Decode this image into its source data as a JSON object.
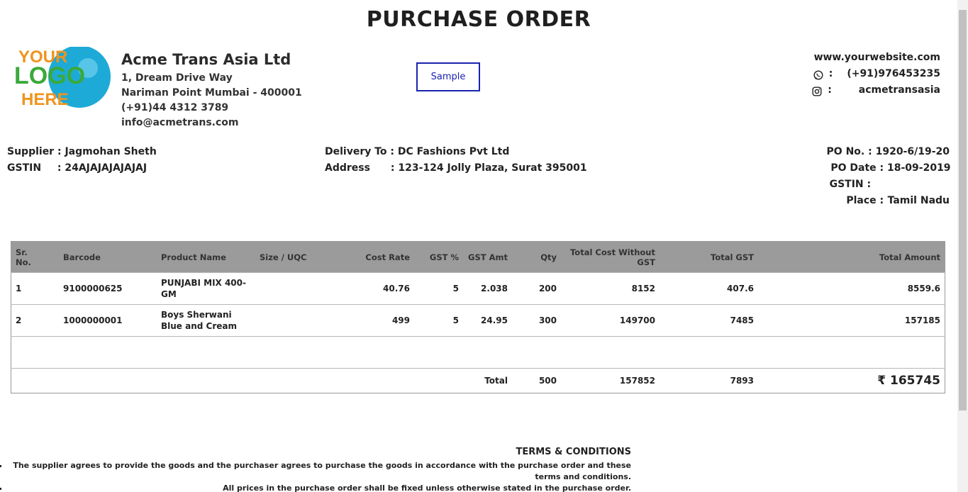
{
  "title": "PURCHASE ORDER",
  "logo": {
    "line1": "YOUR",
    "line2": "LOGO",
    "line3": "HERE"
  },
  "company": {
    "name": "Acme Trans Asia Ltd",
    "address1": "1, Dream Drive Way",
    "address2": "Nariman Point Mumbai - 400001",
    "phone": "(+91)44 4312 3789",
    "email": "info@acmetrans.com"
  },
  "stamp": "Sample",
  "contact": {
    "website": "www.yourwebsite.com",
    "whatsapp_icon": "whatsapp-icon",
    "whatsapp": "(+91)976453235",
    "instagram_icon": "instagram-icon",
    "instagram": "acmetransasia",
    "sep": ":"
  },
  "supplier": {
    "supplier_label": "Supplier :",
    "supplier_value": "Jagmohan Sheth",
    "gstin_label": "GSTIN",
    "gstin_sep": ":",
    "gstin_value": "24AJAJAJAJAJAJ"
  },
  "delivery": {
    "to_label": "Delivery To :",
    "to_value": "DC Fashions Pvt Ltd",
    "address_label": "Address",
    "address_sep": ":",
    "address_value": "123-124 Jolly Plaza, Surat 395001"
  },
  "po": {
    "no_label": "PO No. :",
    "no_value": "1920-6/19-20",
    "date_label": "PO Date :",
    "date_value": "18-09-2019",
    "gstin_label": "GSTIN :",
    "gstin_value": "",
    "place_label": "Place :",
    "place_value": "Tamil Nadu"
  },
  "table": {
    "headers": {
      "sr": "Sr.\nNo.",
      "barcode": "Barcode",
      "product": "Product Name",
      "size": "Size / UQC",
      "cost_rate": "Cost Rate",
      "gst_pct": "GST %",
      "gst_amt": "GST Amt",
      "qty": "Qty",
      "total_wo_gst": "Total Cost Without GST",
      "total_gst": "Total GST",
      "total_amount": "Total Amount"
    },
    "rows": [
      {
        "sr": "1",
        "barcode": "9100000625",
        "product": "PUNJABI MIX 400-GM",
        "size": "",
        "cost_rate": "40.76",
        "gst_pct": "5",
        "gst_amt": "2.038",
        "qty": "200",
        "total_wo_gst": "8152",
        "total_gst": "407.6",
        "total_amount": "8559.6"
      },
      {
        "sr": "2",
        "barcode": "1000000001",
        "product": "Boys Sherwani Blue and Cream",
        "size": "",
        "cost_rate": "499",
        "gst_pct": "5",
        "gst_amt": "24.95",
        "qty": "300",
        "total_wo_gst": "149700",
        "total_gst": "7485",
        "total_amount": "157185"
      }
    ],
    "totals": {
      "label": "Total",
      "qty": "500",
      "total_wo_gst": "157852",
      "total_gst": "7893",
      "total_amount": "₹ 165745"
    }
  },
  "terms": {
    "heading": "TERMS & CONDITIONS",
    "items": [
      "The supplier agrees to provide the goods and the purchaser agrees to purchase the goods in accordance with the purchase order and these terms and conditions.",
      "All prices in the purchase order shall be fixed unless otherwise stated in the purchase order."
    ]
  }
}
